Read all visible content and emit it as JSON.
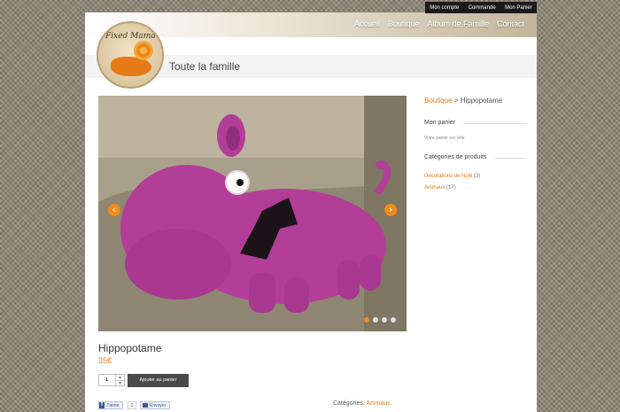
{
  "top_links": [
    "Mon compte",
    "Commande",
    "Mon Panier"
  ],
  "nav": [
    "Accueil",
    "Boutique",
    "Album de Famille",
    "Contact"
  ],
  "logo_text": "Fixed Mama",
  "page_title": "Toute la famille",
  "breadcrumb": {
    "parent": "Boutique",
    "separator": " > ",
    "current": "Hippopotame"
  },
  "cart": {
    "title": "Mon panier",
    "empty_text": "Votre panier est vide"
  },
  "categories": {
    "title": "Catégories de produits",
    "items": [
      {
        "label": "Décorations de Noël",
        "count": "(3)"
      },
      {
        "label": "Animaux",
        "count": "(17)"
      }
    ]
  },
  "slider": {
    "prev": "‹",
    "next": "›",
    "slide_count": 4,
    "active_index": 0
  },
  "product": {
    "name": "Hippopotame",
    "price": "35€",
    "quantity": "1",
    "add_to_cart": "Ajouter au panier"
  },
  "social": {
    "like": "J'aime",
    "like_count": "0",
    "send": "Envoyer"
  },
  "meta": {
    "label": "Catégories: ",
    "category": "Animaux",
    "suffix": "."
  },
  "colors": {
    "accent": "#f08c1a",
    "link": "#e07b17",
    "hippo": "#b33e97"
  }
}
